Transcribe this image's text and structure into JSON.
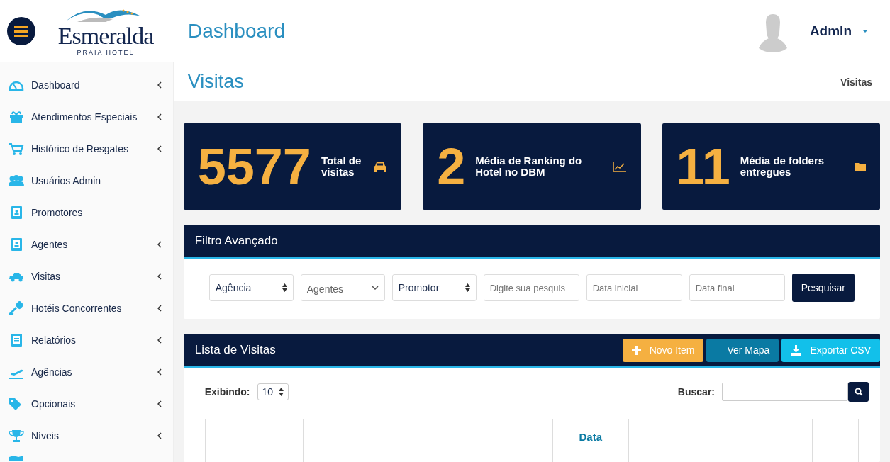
{
  "header": {
    "logo_name": "Esmeralda",
    "logo_sub": "PRAIA HOTEL",
    "page_title": "Dashboard",
    "user": "Admin"
  },
  "sidebar": {
    "items": [
      {
        "label": "Dashboard",
        "has_submenu": true
      },
      {
        "label": "Atendimentos Especiais",
        "has_submenu": true
      },
      {
        "label": "Histórico de Resgates",
        "has_submenu": true
      },
      {
        "label": "Usuários Admin",
        "has_submenu": false
      },
      {
        "label": "Promotores",
        "has_submenu": false
      },
      {
        "label": "Agentes",
        "has_submenu": true
      },
      {
        "label": "Visitas",
        "has_submenu": true
      },
      {
        "label": "Hotéis Concorrentes",
        "has_submenu": true
      },
      {
        "label": "Relatórios",
        "has_submenu": true
      },
      {
        "label": "Agências",
        "has_submenu": true
      },
      {
        "label": "Opcionais",
        "has_submenu": true
      },
      {
        "label": "Níveis",
        "has_submenu": true
      }
    ]
  },
  "page": {
    "title": "Visitas",
    "breadcrumb": "Visitas"
  },
  "stats": [
    {
      "value": "5577",
      "label": "Total de visitas"
    },
    {
      "value": "2",
      "label": "Média de Ranking do Hotel no DBM"
    },
    {
      "value": "11",
      "label": "Média de folders entregues"
    }
  ],
  "filter": {
    "title": "Filtro Avançado",
    "fields": [
      {
        "kind": "select",
        "value": "Agência"
      },
      {
        "kind": "dropdown",
        "value": "Agentes"
      },
      {
        "kind": "select",
        "value": "Promotor"
      },
      {
        "kind": "input",
        "placeholder": "Digite sua pesquis"
      },
      {
        "kind": "input",
        "placeholder": "Data inicial"
      },
      {
        "kind": "input",
        "placeholder": "Data final"
      }
    ],
    "button": "Pesquisar"
  },
  "list": {
    "title": "Lista de Visitas",
    "buttons": [
      {
        "kind": "add",
        "label": "Novo Item"
      },
      {
        "kind": "map",
        "label": "Ver Mapa"
      },
      {
        "kind": "export",
        "label": "Exportar CSV"
      }
    ],
    "show_label": "Exibindo:",
    "page_size": "10",
    "search_label": "Buscar:",
    "columns": [
      "",
      "",
      "",
      "",
      "Data",
      "",
      "",
      ""
    ]
  }
}
